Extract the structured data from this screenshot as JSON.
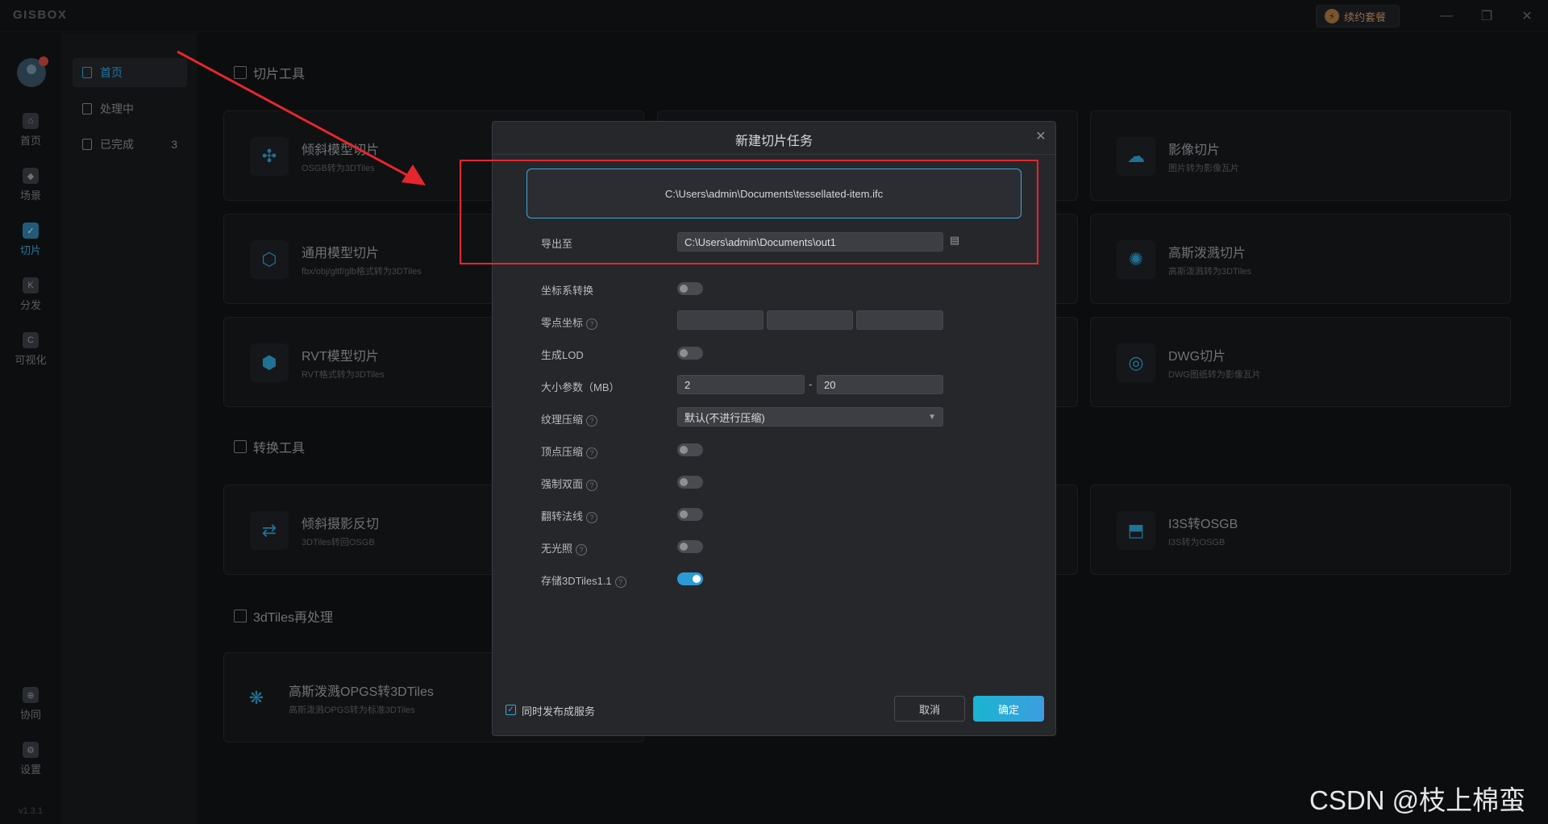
{
  "app": {
    "logo": "GISBOX",
    "package_button": "续约套餐",
    "minimize": "—",
    "restore": "❐",
    "close": "✕"
  },
  "rail": {
    "items": [
      {
        "label": "首页",
        "icon": "⌂"
      },
      {
        "label": "场景",
        "icon": "◆"
      },
      {
        "label": "切片",
        "icon": "✓"
      },
      {
        "label": "分发",
        "icon": "K"
      },
      {
        "label": "可视化",
        "icon": "C"
      }
    ],
    "bottom_items": [
      {
        "label": "协同",
        "icon": "⊕"
      },
      {
        "label": "设置",
        "icon": "⚙"
      }
    ],
    "version": "v1.3.1"
  },
  "subnav": {
    "items": [
      {
        "label": "首页",
        "count": ""
      },
      {
        "label": "处理中",
        "count": ""
      },
      {
        "label": "已完成",
        "count": "3"
      }
    ]
  },
  "sections": [
    {
      "title": "切片工具"
    },
    {
      "title": "转换工具"
    },
    {
      "title": "3dTiles再处理"
    }
  ],
  "cards": [
    {
      "title": "倾斜模型切片",
      "subtitle": "OSGB转为3DTiles",
      "icon": "✣"
    },
    {
      "title": "通用模型切片",
      "subtitle": "fbx/obj/gltf/glb格式转为3DTiles",
      "icon": "⬡"
    },
    {
      "title": "RVT模型切片",
      "subtitle": "RVT格式转为3DTiles",
      "icon": "⬢"
    },
    {
      "title": "影像切片",
      "subtitle": "图片转为影像瓦片",
      "icon": "☁"
    },
    {
      "title": "高斯泼溅切片",
      "subtitle": "高斯泼溅转为3DTiles",
      "icon": "✺"
    },
    {
      "title": "DWG切片",
      "subtitle": "DWG图纸转为影像瓦片",
      "icon": "◎"
    },
    {
      "title": "倾斜摄影反切",
      "subtitle": "3DTiles转回OSGB",
      "icon": "⇄"
    },
    {
      "title": "I3S转OSGB",
      "subtitle": "I3S转为OSGB",
      "icon": "⬒"
    },
    {
      "title": "高斯泼溅OPGS转3DTiles",
      "subtitle": "高斯泼溅OPGS转为标准3DTiles",
      "icon": "❋"
    }
  ],
  "modal": {
    "title": "新建切片任务",
    "close_icon": "✕",
    "file_path": "C:\\Users\\admin\\Documents\\tessellated-item.ifc",
    "export_label": "导出至",
    "export_path": "C:\\Users\\admin\\Documents\\out1",
    "help_glyph": "?",
    "fields": {
      "coord_transform": "坐标系转换",
      "origin": "零点坐标",
      "generate_lod": "生成LOD",
      "size_params": "大小参数（MB）",
      "size_min": "2",
      "size_dash": "-",
      "size_max": "20",
      "texture_compress": "纹理压缩",
      "texture_value": "默认(不进行压缩)",
      "vertex_compress": "顶点压缩",
      "double_side": "强制双面",
      "flip_normals": "翻转法线",
      "no_lighting": "无光照",
      "store_3dtiles": "存储3DTiles1.1"
    },
    "toggles": {
      "coord_transform": false,
      "generate_lod": false,
      "vertex_compress": false,
      "double_side": false,
      "flip_normals": false,
      "no_lighting": false,
      "store_3dtiles": true
    },
    "publish_label": "同时发布成服务",
    "publish_checked": true,
    "cancel": "取消",
    "ok": "确定"
  },
  "watermark": "CSDN @枝上棉蛮",
  "colors": {
    "accent": "#2b9bd6",
    "highlight": "#e5262d"
  }
}
